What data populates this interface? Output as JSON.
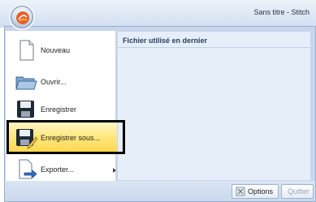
{
  "window": {
    "title": "Sans titre - Stitch"
  },
  "menu": {
    "items": [
      {
        "label": "Nouveau",
        "icon": "new-document-icon"
      },
      {
        "label": "Ouvrir...",
        "icon": "open-folder-icon"
      },
      {
        "label": "Enregistrer",
        "icon": "save-icon"
      },
      {
        "label": "Enregistrer sous...",
        "icon": "save-as-icon",
        "highlighted": true
      },
      {
        "label": "Exporter...",
        "icon": "export-icon",
        "has_submenu": true
      }
    ]
  },
  "recent": {
    "header": "Fichier utilisé en dernier"
  },
  "footer": {
    "options_label": "Options",
    "quit_label": "Quitter"
  },
  "colors": {
    "highlight": "#ffe880",
    "callout_border": "#000000",
    "panel_bg": "#c6d6ec"
  }
}
